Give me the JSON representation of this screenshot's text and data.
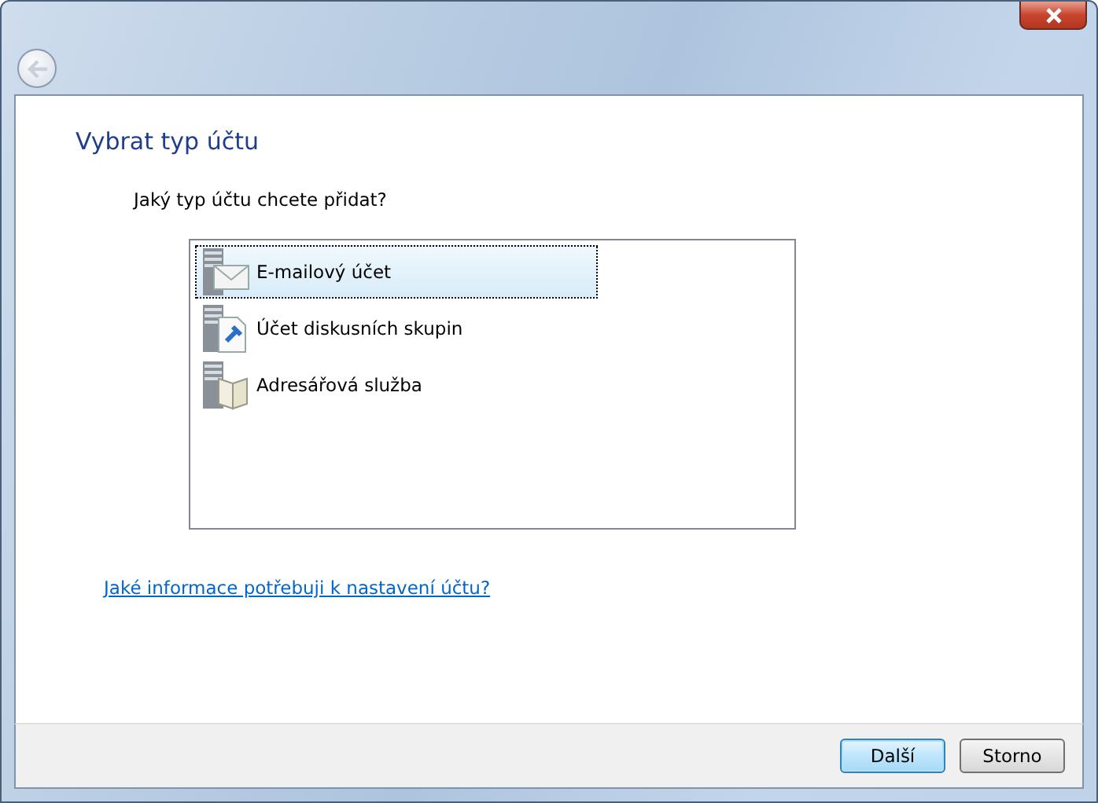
{
  "heading": "Vybrat typ účtu",
  "question": "Jaký typ účtu chcete přidat?",
  "account_types": [
    {
      "kind": "mail",
      "label": "E-mailový účet",
      "selected": true
    },
    {
      "kind": "news",
      "label": "Účet diskusních skupin",
      "selected": false
    },
    {
      "kind": "directory",
      "label": "Adresářová služba",
      "selected": false
    }
  ],
  "help_link": "Jaké informace potřebuji k nastavení účtu?",
  "buttons": [
    {
      "label": "Další",
      "default": true
    },
    {
      "label": "Storno",
      "default": false
    }
  ]
}
